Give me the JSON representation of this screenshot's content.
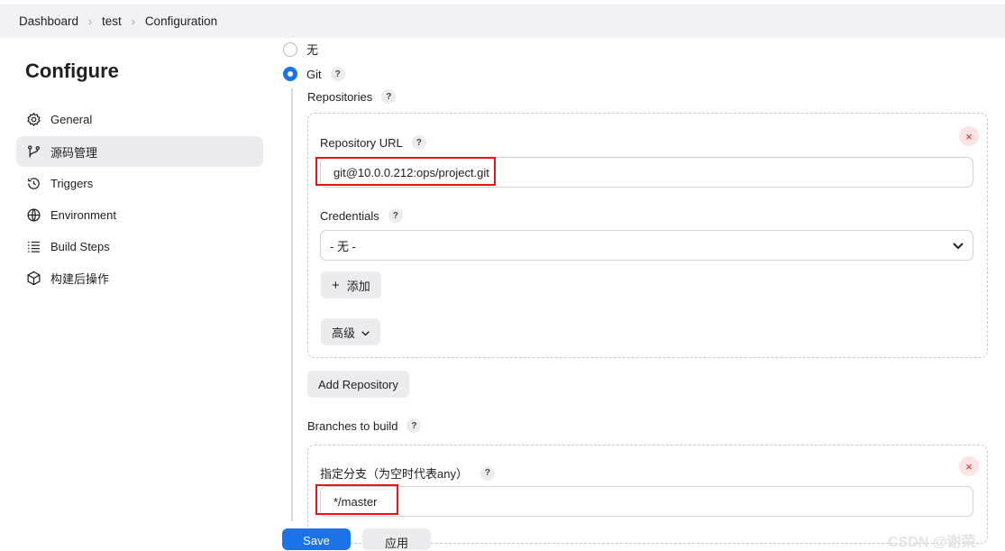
{
  "breadcrumb": [
    "Dashboard",
    "test",
    "Configuration"
  ],
  "sidebar": {
    "title": "Configure",
    "items": [
      {
        "label": "General",
        "icon": "gear-icon"
      },
      {
        "label": "源码管理",
        "icon": "branch-icon"
      },
      {
        "label": "Triggers",
        "icon": "clock-icon"
      },
      {
        "label": "Environment",
        "icon": "globe-icon"
      },
      {
        "label": "Build Steps",
        "icon": "list-icon"
      },
      {
        "label": "构建后操作",
        "icon": "box-icon"
      }
    ]
  },
  "scm": {
    "option_none": "无",
    "option_git": "Git",
    "repositories_label": "Repositories",
    "repo_url_label": "Repository URL",
    "repo_url_value": "git@10.0.0.212:ops/project.git",
    "credentials_label": "Credentials",
    "credentials_value": "- 无 -",
    "add_label": "添加",
    "advanced_label": "高级",
    "add_repository_label": "Add Repository",
    "branches_label": "Branches to build",
    "branch_spec_label": "指定分支（为空时代表any）",
    "branch_spec_value": "*/master",
    "help_glyph": "?",
    "remove_glyph": "×"
  },
  "footer": {
    "save_label": "Save",
    "apply_label": "应用",
    "watermark": "CSDN @谢荣"
  },
  "colors": {
    "accent": "#1a73e8",
    "highlight": "#e8141a"
  }
}
